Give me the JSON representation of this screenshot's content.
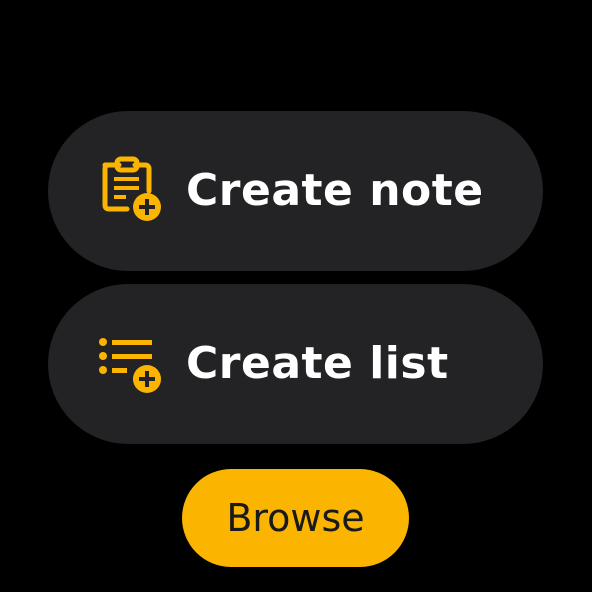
{
  "colors": {
    "background": "#000000",
    "chip_background": "#232325",
    "accent": "#fbb500",
    "chip_text": "#ffffff",
    "browse_text": "#1a1a1a"
  },
  "actions": {
    "create_note": {
      "label": "Create note",
      "icon": "note-add-icon"
    },
    "create_list": {
      "label": "Create list",
      "icon": "list-add-icon"
    }
  },
  "browse": {
    "label": "Browse"
  }
}
